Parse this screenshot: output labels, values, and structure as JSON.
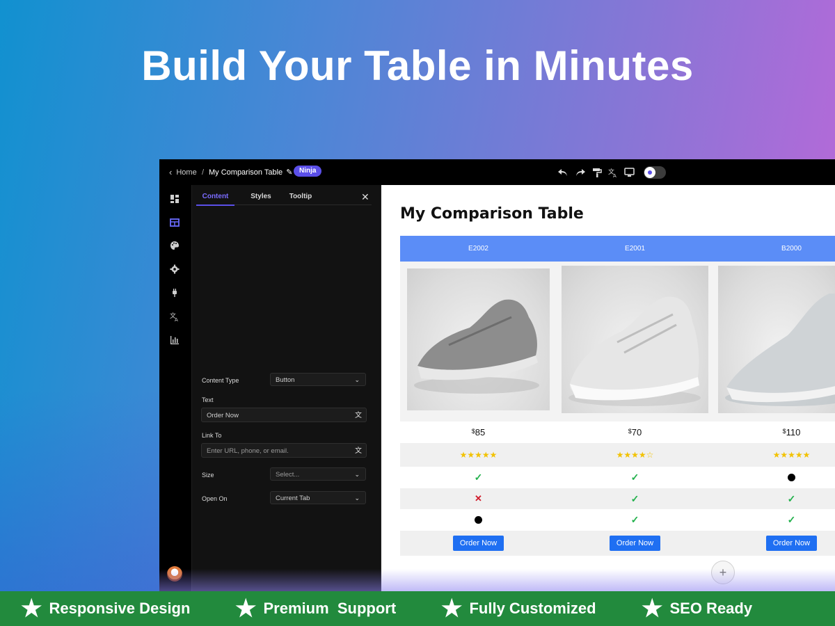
{
  "hero": {
    "headline": "Build Your Table in Minutes"
  },
  "topbar": {
    "back_label": "Home",
    "separator": "/",
    "table_name": "My Comparison Table",
    "badge": "Ninja",
    "icons": [
      "undo-icon",
      "redo-icon",
      "paint-roller-icon",
      "translate-icon",
      "desktop-preview-icon",
      "theme-toggle"
    ]
  },
  "rail": {
    "icons": [
      "dashboard-icon",
      "table-icon",
      "palette-icon",
      "settings-icon",
      "plug-icon",
      "translate-icon",
      "chart-icon",
      "avatar"
    ]
  },
  "panel": {
    "tabs": [
      {
        "label": "Content",
        "active": true
      },
      {
        "label": "Styles",
        "active": false
      },
      {
        "label": "Tooltip",
        "active": false
      }
    ],
    "close_icon": "close-icon",
    "content_type_label": "Content Type",
    "content_type_value": "Button",
    "text_label": "Text",
    "text_value": "Order Now",
    "link_label": "Link To",
    "link_placeholder": "Enter URL, phone, or email.",
    "size_label": "Size",
    "size_placeholder": "Select...",
    "open_on_label": "Open On",
    "open_on_value": "Current Tab"
  },
  "canvas": {
    "title": "My Comparison Table",
    "columns": [
      "E2002",
      "E2001",
      "B2000"
    ],
    "currency": "$",
    "prices": [
      "85",
      "70",
      "110"
    ],
    "ratings": [
      5,
      4,
      5
    ],
    "star_full": "★★★★★",
    "star_four": "★★★★",
    "star_empty": "☆",
    "feature_rows": [
      [
        "check",
        "check",
        "dot"
      ],
      [
        "cross",
        "check",
        "check"
      ],
      [
        "dot",
        "check",
        "check"
      ]
    ],
    "button_label": "Order Now",
    "add_label": "+",
    "colors": {
      "header": "#5b8df7",
      "button": "#1f6ff2",
      "check": "#22b14c",
      "cross": "#d11a2a",
      "accent": "#5b4fe8"
    }
  },
  "footer": {
    "features": [
      "Responsive Design",
      "Premium  Support",
      "Fully Customized",
      "SEO Ready"
    ],
    "star_icon": "★",
    "color": "#228a3d"
  }
}
